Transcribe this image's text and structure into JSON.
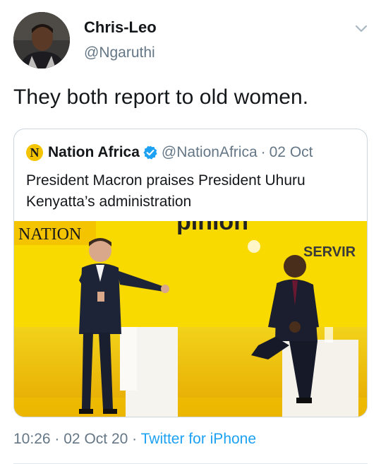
{
  "tweet": {
    "author_name": "Chris-Leo",
    "author_handle": "@Ngaruthi",
    "text": "They both report to old women.",
    "time": "10:26",
    "date": "02 Oct 20",
    "separator": "·",
    "source": "Twitter for iPhone"
  },
  "quoted": {
    "logo_letter": "N",
    "name": "Nation Africa",
    "handle": "@NationAfrica",
    "separator": "·",
    "date": "02 Oct",
    "text": "President Macron praises President Uhuru Kenyatta’s administration",
    "media": {
      "watermark": "NATION",
      "banner_text": "SERVIR",
      "banner_partial": "pinion"
    }
  },
  "colors": {
    "link": "#1da1f2",
    "secondary_text": "#657786",
    "border": "#ccd6dd",
    "verified": "#1da1f2",
    "stage_yellow": "#f7d400"
  },
  "icons": {
    "menu": "chevron-down-icon",
    "verified": "verified-badge-icon"
  }
}
